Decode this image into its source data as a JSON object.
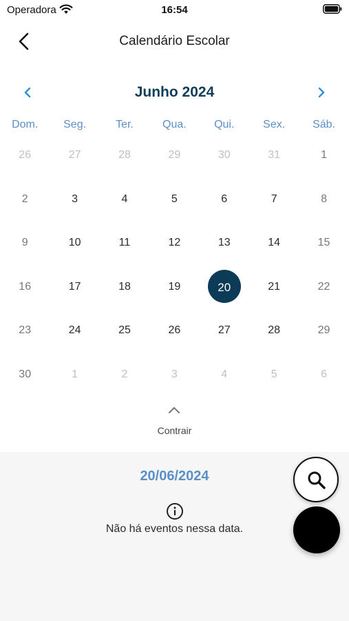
{
  "status_bar": {
    "carrier": "Operadora",
    "time": "16:54",
    "wifi_icon": "wifi-icon",
    "battery_icon": "battery-icon"
  },
  "nav": {
    "title": "Calendário Escolar",
    "back_icon": "chevron-left-icon"
  },
  "calendar": {
    "month_title": "Junho 2024",
    "prev_icon": "chevron-left-icon",
    "next_icon": "chevron-right-icon",
    "weekdays": [
      "Dom.",
      "Seg.",
      "Ter.",
      "Qua.",
      "Qui.",
      "Sex.",
      "Sáb."
    ],
    "weeks": [
      [
        "26",
        "27",
        "28",
        "29",
        "30",
        "31",
        "1"
      ],
      [
        "2",
        "3",
        "4",
        "5",
        "6",
        "7",
        "8"
      ],
      [
        "9",
        "10",
        "11",
        "12",
        "13",
        "14",
        "15"
      ],
      [
        "16",
        "17",
        "18",
        "19",
        "20",
        "21",
        "22"
      ],
      [
        "23",
        "24",
        "25",
        "26",
        "27",
        "28",
        "29"
      ],
      [
        "30",
        "1",
        "2",
        "3",
        "4",
        "5",
        "6"
      ]
    ],
    "outside_month": [
      [
        true,
        true,
        true,
        true,
        true,
        true,
        false
      ],
      [
        false,
        false,
        false,
        false,
        false,
        false,
        false
      ],
      [
        false,
        false,
        false,
        false,
        false,
        false,
        false
      ],
      [
        false,
        false,
        false,
        false,
        false,
        false,
        false
      ],
      [
        false,
        false,
        false,
        false,
        false,
        false,
        false
      ],
      [
        false,
        true,
        true,
        true,
        true,
        true,
        true
      ]
    ],
    "selected_day": "20",
    "colors": {
      "selected_bg": "#0c3b57",
      "accent": "#5b8fc7",
      "month_title": "#0f3d5a"
    }
  },
  "collapse": {
    "label": "Contrair",
    "icon": "chevron-up-icon"
  },
  "events": {
    "selected_date": "20/06/2024",
    "empty_message": "Não há eventos nessa data.",
    "info_icon": "info-icon"
  },
  "fabs": {
    "search_icon": "search-icon"
  }
}
